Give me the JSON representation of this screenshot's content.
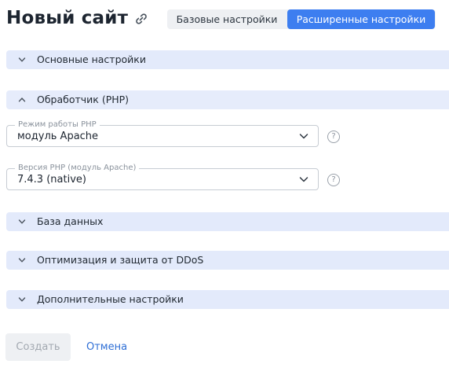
{
  "header": {
    "title": "Новый сайт",
    "link_icon": "link-icon"
  },
  "mode_switch": {
    "basic_label": "Базовые настройки",
    "advanced_label": "Расширенные настройки",
    "active": "advanced",
    "active_color": "#3d7ef0"
  },
  "sections": {
    "main": {
      "label": "Основные настройки",
      "expanded": false
    },
    "php": {
      "label": "Обработчик (PHP)",
      "expanded": true
    },
    "database": {
      "label": "База данных",
      "expanded": false
    },
    "ddos": {
      "label": "Оптимизация и защита от DDoS",
      "expanded": false
    },
    "extra": {
      "label": "Дополнительные настройки",
      "expanded": false
    }
  },
  "php_fields": {
    "mode": {
      "label": "Режим работы PHP",
      "value": "модуль Apache",
      "help": "?"
    },
    "version": {
      "label": "Версия PHP (модуль Apache)",
      "value": "7.4.3 (native)",
      "help": "?"
    }
  },
  "footer": {
    "create_label": "Создать",
    "create_disabled": true,
    "cancel_label": "Отмена"
  },
  "colors": {
    "section_bar": "#e3eafb",
    "link": "#2f6fd6",
    "accent": "#3d7ef0"
  }
}
